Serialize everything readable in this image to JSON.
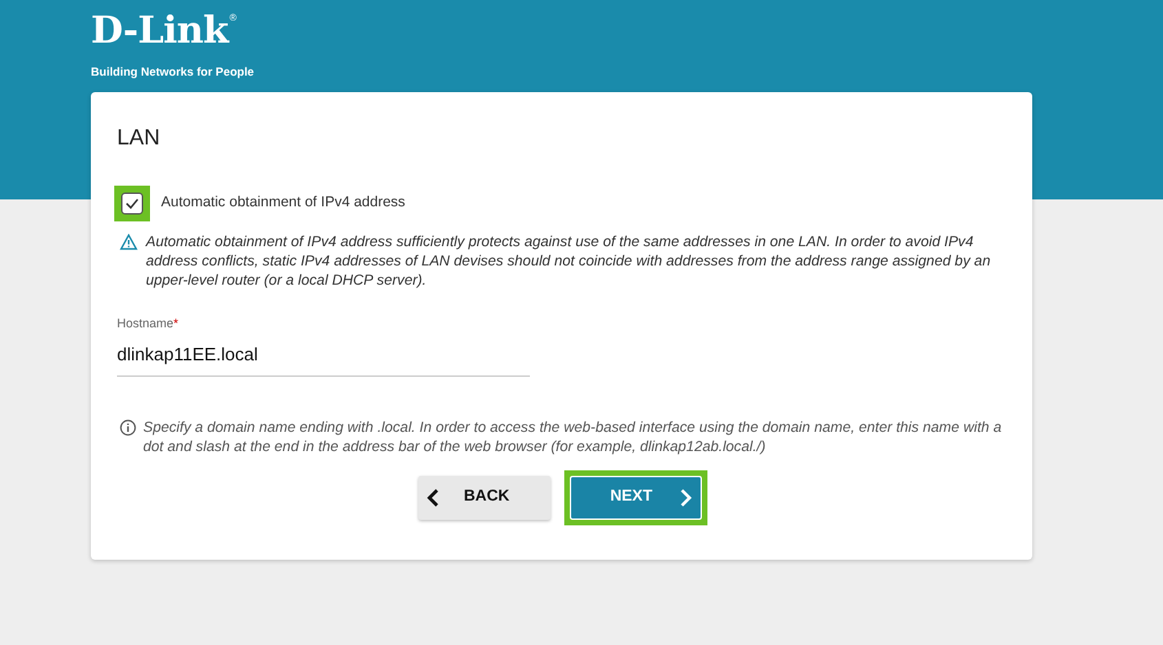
{
  "logo": {
    "name": "D-Link",
    "mark": "®",
    "tagline": "Building Networks for People"
  },
  "card": {
    "title": "LAN",
    "checkbox": {
      "label": "Automatic obtainment of IPv4 address",
      "checked": true,
      "highlighted": true
    },
    "warning": "Automatic obtainment of IPv4 address sufficiently protects against use of the same addresses in one LAN. In order to avoid IPv4 address conflicts, static IPv4 addresses of LAN devises should not coincide with addresses from the address range assigned by an upper-level router (or a local DHCP server).",
    "hostname": {
      "label": "Hostname",
      "required_mark": "*",
      "value": "dlinkap11EE.local"
    },
    "info": "Specify a domain name ending with .local. In order to access the web-based interface using the domain name, enter this name with a dot and slash at the end in the address bar of the web browser (for example, dlinkap12ab.local./)",
    "buttons": [
      {
        "kind": "back",
        "label": "BACK",
        "highlighted": false
      },
      {
        "kind": "next",
        "label": "NEXT",
        "highlighted": true
      }
    ]
  }
}
